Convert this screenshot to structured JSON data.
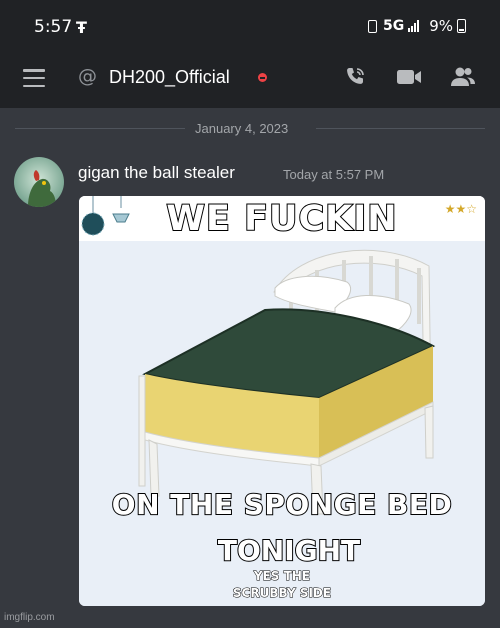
{
  "status_bar": {
    "time": "5:57",
    "carrier_icon": "t-mobile-icon",
    "network": "5G",
    "battery": "9%"
  },
  "header": {
    "channel_name": "DH200_Official",
    "status": "do-not-disturb",
    "icons": [
      "menu-icon",
      "at-icon",
      "call-icon",
      "video-icon",
      "members-icon"
    ]
  },
  "divider": {
    "date": "January 4, 2023"
  },
  "message": {
    "author": "gigan the ball stealer",
    "timestamp": "Today at 5:57 PM",
    "image": {
      "top_text": "WE FUCKIN",
      "bottom_line1": "ON THE SPONGE BED",
      "bottom_line2": "TONIGHT",
      "small_line1": "YES THE",
      "small_line2": "SCRUBBY SIDE"
    }
  },
  "watermark": "imgflip.com",
  "colors": {
    "background": "#36393f",
    "header": "#202225",
    "text": "#dcddde",
    "muted": "#a3a6aa",
    "dnd": "#ed4245"
  }
}
